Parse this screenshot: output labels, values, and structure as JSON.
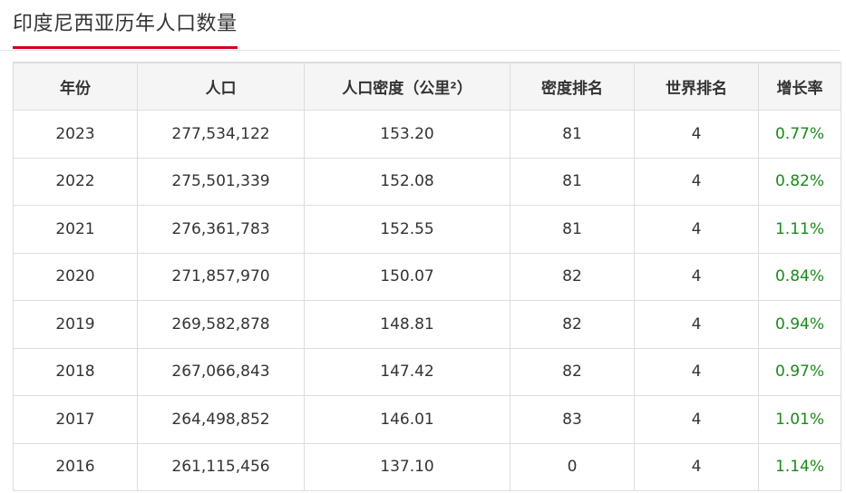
{
  "page": {
    "title": "印度尼西亚历年人口数量"
  },
  "colors": {
    "accent": "#d0021b",
    "growth": "#1a8a1a",
    "header_bg": "#f5f5f5",
    "border": "#dddddd"
  },
  "table": {
    "headers": [
      "年份",
      "人口",
      "人口密度（公里²）",
      "密度排名",
      "世界排名",
      "增长率"
    ],
    "rows": [
      [
        "2023",
        "277,534,122",
        "153.20",
        "81",
        "4",
        "0.77%"
      ],
      [
        "2022",
        "275,501,339",
        "152.08",
        "81",
        "4",
        "0.82%"
      ],
      [
        "2021",
        "276,361,783",
        "152.55",
        "81",
        "4",
        "1.11%"
      ],
      [
        "2020",
        "271,857,970",
        "150.07",
        "82",
        "4",
        "0.84%"
      ],
      [
        "2019",
        "269,582,878",
        "148.81",
        "82",
        "4",
        "0.94%"
      ],
      [
        "2018",
        "267,066,843",
        "147.42",
        "82",
        "4",
        "0.97%"
      ],
      [
        "2017",
        "264,498,852",
        "146.01",
        "83",
        "4",
        "1.01%"
      ],
      [
        "2016",
        "261,115,456",
        "137.10",
        "0",
        "4",
        "1.14%"
      ]
    ]
  }
}
